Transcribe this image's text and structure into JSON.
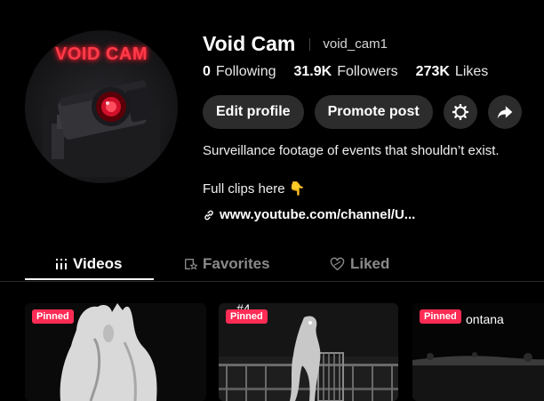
{
  "profile": {
    "avatar_title": "VOID CAM",
    "display_name": "Void Cam",
    "username": "void_cam1"
  },
  "stats": {
    "following_count": "0",
    "following_label": "Following",
    "followers_count": "31.9K",
    "followers_label": "Followers",
    "likes_count": "273K",
    "likes_label": "Likes"
  },
  "actions": {
    "edit_profile": "Edit profile",
    "promote_post": "Promote post",
    "settings_icon": "gear-icon",
    "share_icon": "share-icon"
  },
  "bio": {
    "line1": "Surveillance footage of events that shouldn’t exist.",
    "line2": "Full clips here 👇",
    "link": "www.youtube.com/channel/U..."
  },
  "tabs": [
    {
      "label": "Videos",
      "icon": "grid-icon",
      "active": true
    },
    {
      "label": "Favorites",
      "icon": "bookmark-icon",
      "active": false
    },
    {
      "label": "Liked",
      "icon": "heart-icon",
      "active": false
    }
  ],
  "videos": [
    {
      "badge": "Pinned",
      "overlay_text": ""
    },
    {
      "badge": "Pinned",
      "overlay_text": "#4"
    },
    {
      "badge": "Pinned",
      "overlay_text": "ontana"
    }
  ],
  "colors": {
    "background": "#000000",
    "button": "#2c2c2c",
    "accent_pinned": "#fe2c55",
    "avatar_neon": "#ff3b4a"
  }
}
